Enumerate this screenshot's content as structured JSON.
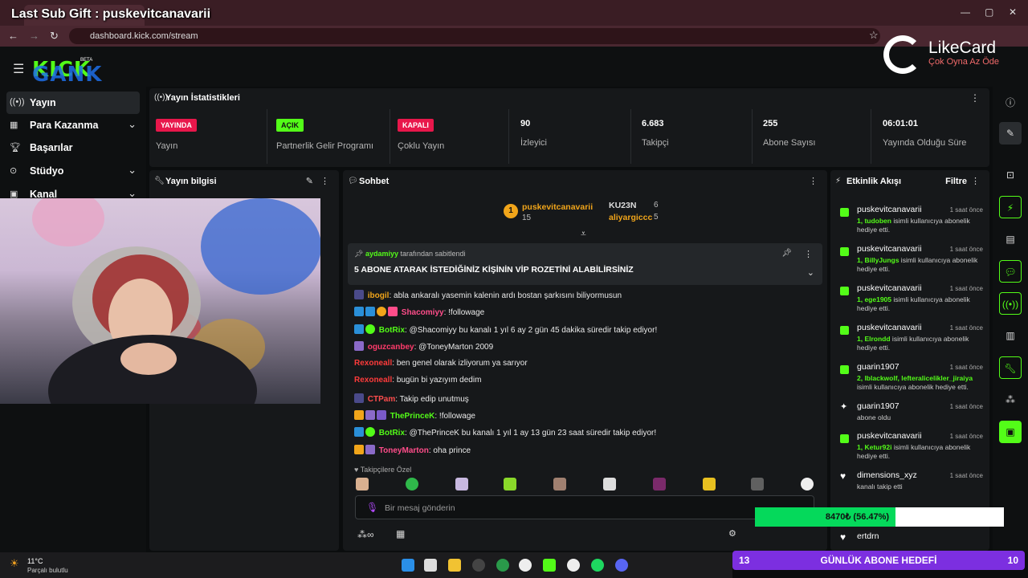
{
  "overlay_title": "Last Sub Gift : puskevitcanavarii",
  "browser": {
    "tab_title": "Stream - Kick Dashboard",
    "url": "dashboard.kick.com/stream"
  },
  "brand": {
    "logo": "KICK",
    "beta": "BETA",
    "overlay_text": "GANK"
  },
  "likecard": {
    "name": "LikeCard",
    "slogan": "Çok Oyna  Az Öde"
  },
  "sidebar": {
    "items": [
      {
        "label": "Yayın",
        "icon": "broadcast-icon",
        "active": true
      },
      {
        "label": "Para Kazanma",
        "icon": "money-icon",
        "expandable": true
      },
      {
        "label": "Başarılar",
        "icon": "trophy-icon"
      },
      {
        "label": "Stüdyo",
        "icon": "studio-icon",
        "expandable": true
      },
      {
        "label": "Kanal",
        "icon": "channel-icon",
        "expandable": true
      }
    ]
  },
  "stats": {
    "title": "Yayın İstatistikleri",
    "cells": [
      {
        "badge": "YAYINDA",
        "label": "Yayın",
        "badge_color": "#e8174b"
      },
      {
        "badge": "AÇIK",
        "label": "Partnerlik Gelir Programı",
        "badge_color": "#53fc18"
      },
      {
        "badge": "KAPALI",
        "label": "Çoklu Yayın",
        "badge_color": "#e8174b"
      },
      {
        "value": "90",
        "label": "İzleyici"
      },
      {
        "value": "6.683",
        "label": "Takipçi"
      },
      {
        "value": "255",
        "label": "Abone Sayısı"
      },
      {
        "value": "06:01:01",
        "label": "Yayında Olduğu Süre"
      }
    ]
  },
  "info_panel": {
    "title": "Yayın bilgisi"
  },
  "chat": {
    "title": "Sohbet",
    "leaderboard": [
      {
        "rank": "1",
        "name": "puskevitcanavarii",
        "count": "15"
      },
      {
        "name": "KU23N",
        "count": "6"
      },
      {
        "name": "aliyargiccc",
        "count": "5"
      }
    ],
    "pinned_by_user": "aydamiyy",
    "pinned_by_suffix": "tarafından sabitlendi",
    "pinned_text": "5 ABONE ATARAK İSTEDİĞİNİZ KİŞİNİN VİP ROZETİNİ ALABİLİRSİNİZ",
    "messages": [
      {
        "user": "ibogil",
        "color": "#f1a51a",
        "text": "abla ankaralı yasemin kalenin ardı bostan şarkısını biliyormusun"
      },
      {
        "user": "Shacomiyy",
        "color": "#ff4d8a",
        "text": "!followage"
      },
      {
        "user": "BotRix",
        "color": "#53fc18",
        "text": "@Shacomiyy bu kanalı 1 yıl 6 ay 2 gün 45 dakika süredir takip ediyor!"
      },
      {
        "user": "oguzcanbey",
        "color": "#ff3b6b",
        "text": "@ToneyMarton 2009"
      },
      {
        "user": "Rexoneall",
        "color": "#ff3b3b",
        "text": "ben genel olarak izliyorum ya sarıyor"
      },
      {
        "user": "Rexoneall",
        "color": "#ff3b3b",
        "text": "bugün bi yazıyım dedim"
      },
      {
        "user": "CTPam",
        "color": "#ff4d4d",
        "text": "Takip edip unutmuş"
      },
      {
        "user": "ThePrinceK",
        "color": "#53fc18",
        "text": "!followage"
      },
      {
        "user": "BotRix",
        "color": "#53fc18",
        "text": "@ThePrinceK bu kanalı 1 yıl 1 ay 13 gün 23 saat süredir takip ediyor!"
      },
      {
        "user": "ToneyMarton",
        "color": "#ff4d8a",
        "text": "oha prince"
      }
    ],
    "followers_only": "Takipçilere Özel",
    "input_placeholder": "Bir mesaj gönderin"
  },
  "events": {
    "title": "Etkinlik Akışı",
    "filter": "Filtre",
    "items": [
      {
        "user": "puskevitcanavarii",
        "time": "1 saat önce",
        "hl": "1, tudoben",
        "desc": " isimli kullanıcıya abonelik hediye etti.",
        "icon_color": "#53fc18"
      },
      {
        "user": "puskevitcanavarii",
        "time": "1 saat önce",
        "hl": "1, BillyJungs",
        "desc": " isimli kullanıcıya abonelik hediye etti.",
        "icon_color": "#53fc18"
      },
      {
        "user": "puskevitcanavarii",
        "time": "1 saat önce",
        "hl": "1, ege1905",
        "desc": " isimli kullanıcıya abonelik hediye etti.",
        "icon_color": "#53fc18"
      },
      {
        "user": "puskevitcanavarii",
        "time": "1 saat önce",
        "hl": "1, Elrondd",
        "desc": " isimli kullanıcıya abonelik hediye etti.",
        "icon_color": "#53fc18"
      },
      {
        "user": "guarin1907",
        "time": "1 saat önce",
        "hl": "2, lblackwolf, lefteralicelikler_jiraiya",
        "desc": " isimli kullanıcıya abonelik hediye etti.",
        "icon_color": "#53fc18"
      },
      {
        "user": "guarin1907",
        "time": "1 saat önce",
        "hl": "",
        "desc": "abone oldu",
        "icon_color": "#ffffff"
      },
      {
        "user": "puskevitcanavarii",
        "time": "1 saat önce",
        "hl": "1, Ketur92i",
        "desc": " isimli kullanıcıya abonelik hediye etti.",
        "icon_color": "#53fc18"
      },
      {
        "user": "dimensions_xyz",
        "time": "1 saat önce",
        "hl": "",
        "desc": "kanalı takip etti",
        "icon_color": "#ffffff"
      },
      {
        "user": "ertdrn",
        "time": "",
        "hl": "",
        "desc": "",
        "icon_color": "#ffffff"
      }
    ]
  },
  "goal": {
    "text": "8470₺ (56.47%)",
    "fraction": 0.5647
  },
  "banner": {
    "left": "13",
    "title": "GÜNLÜK ABONE HEDEFİ",
    "right": "10"
  },
  "taskbar": {
    "temp": "11°C",
    "weather": "Parçalı bulutlu"
  }
}
